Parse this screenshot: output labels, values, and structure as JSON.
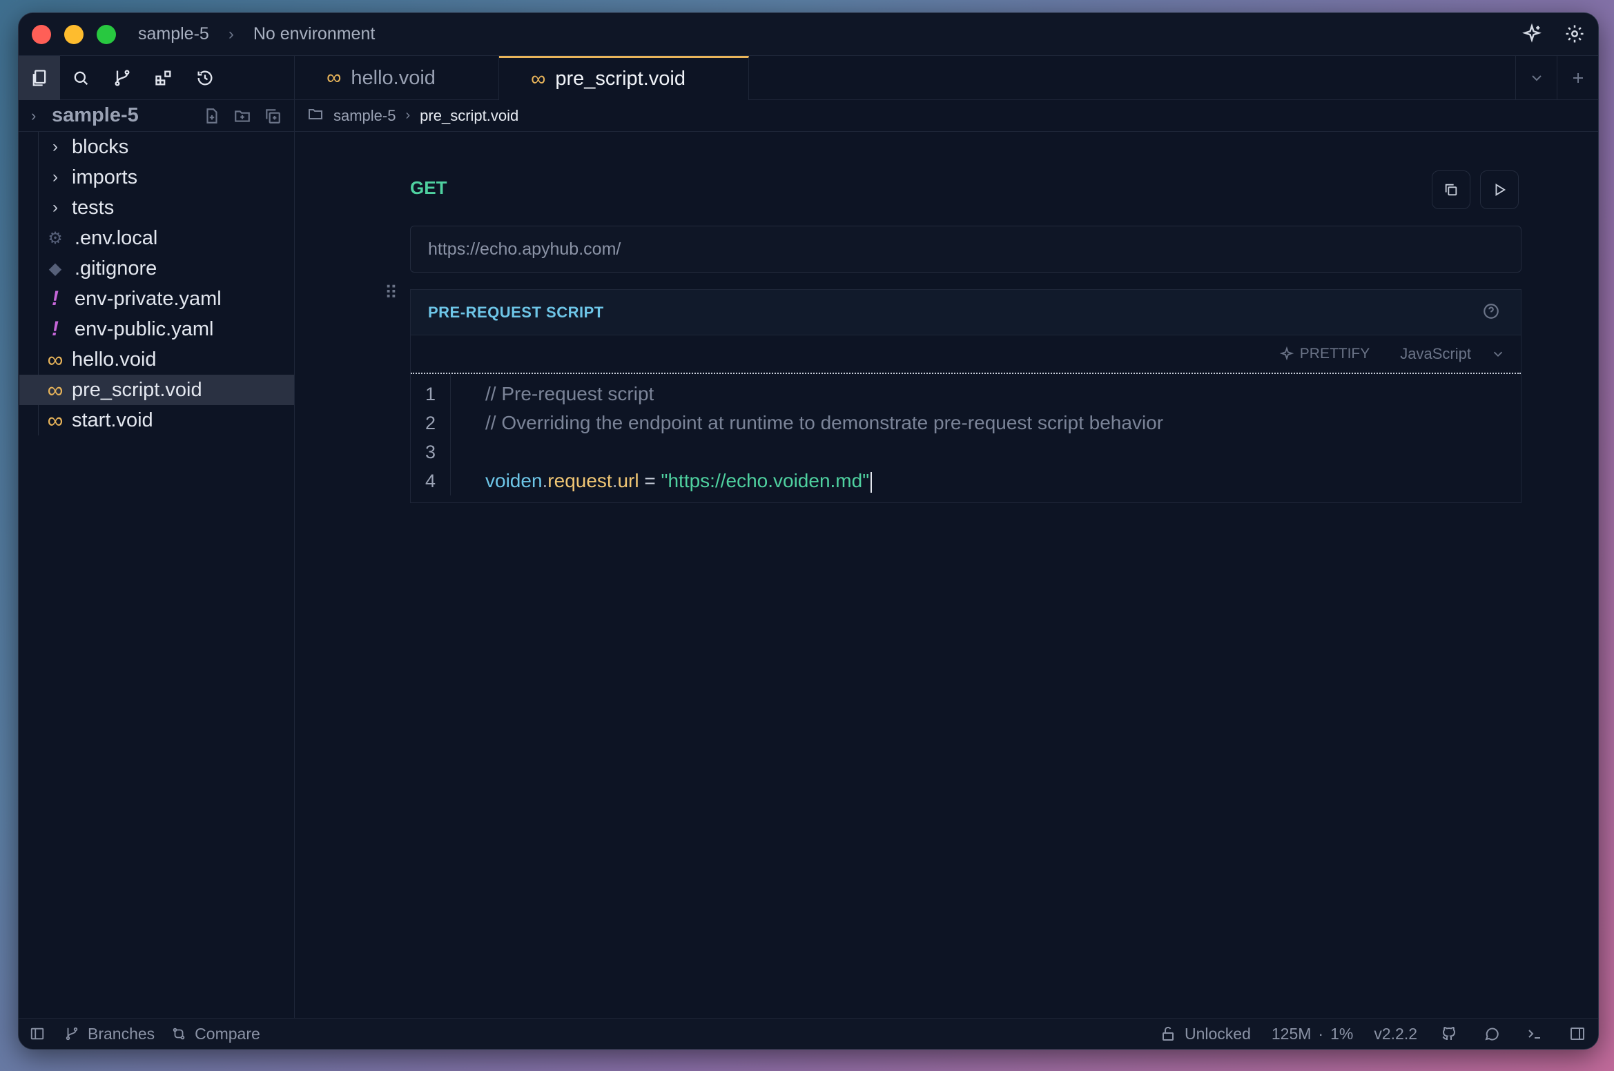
{
  "titlebar": {
    "project": "sample-5",
    "environment": "No environment"
  },
  "sidebar": {
    "project_name": "sample-5",
    "tree": [
      {
        "label": "blocks",
        "icon": "chevron-right-icon",
        "type": "folder"
      },
      {
        "label": "imports",
        "icon": "chevron-right-icon",
        "type": "folder"
      },
      {
        "label": "tests",
        "icon": "chevron-right-icon",
        "type": "folder"
      },
      {
        "label": ".env.local",
        "icon": "gear-icon",
        "type": "file"
      },
      {
        "label": ".gitignore",
        "icon": "git-icon",
        "type": "file"
      },
      {
        "label": "env-private.yaml",
        "icon": "exclamation-icon",
        "type": "file"
      },
      {
        "label": "env-public.yaml",
        "icon": "exclamation-icon",
        "type": "file"
      },
      {
        "label": "hello.void",
        "icon": "infinity-icon",
        "type": "file"
      },
      {
        "label": "pre_script.void",
        "icon": "infinity-icon",
        "type": "file",
        "selected": true
      },
      {
        "label": "start.void",
        "icon": "infinity-icon",
        "type": "file"
      }
    ]
  },
  "tabs": [
    {
      "label": "hello.void",
      "active": false
    },
    {
      "label": "pre_script.void",
      "active": true
    }
  ],
  "breadcrumb": {
    "folder": "sample-5",
    "file": "pre_script.void"
  },
  "request": {
    "method": "GET",
    "url": "https://echo.apyhub.com/"
  },
  "script_block": {
    "title": "PRE-REQUEST SCRIPT",
    "prettify_label": "PRETTIFY",
    "language": "JavaScript",
    "line_numbers": [
      "1",
      "2",
      "3",
      "4"
    ],
    "lines": {
      "l1": "// Pre-request script",
      "l2": "// Overriding the endpoint at runtime to demonstrate pre-request script behavior",
      "l4_obj": "voiden",
      "l4_dot1": ".",
      "l4_prop1": "request",
      "l4_dot2": ".",
      "l4_prop2": "url",
      "l4_op": " = ",
      "l4_str": "\"https://echo.voiden.md\""
    }
  },
  "statusbar": {
    "branches": "Branches",
    "compare": "Compare",
    "lock_status": "Unlocked",
    "memory": "125M",
    "separator": "·",
    "cpu": "1%",
    "version": "v2.2.2"
  },
  "colors": {
    "accent": "#e8b45a",
    "method_get": "#4fd1a0",
    "script_title": "#6ec6e8",
    "background": "#0d1424"
  }
}
